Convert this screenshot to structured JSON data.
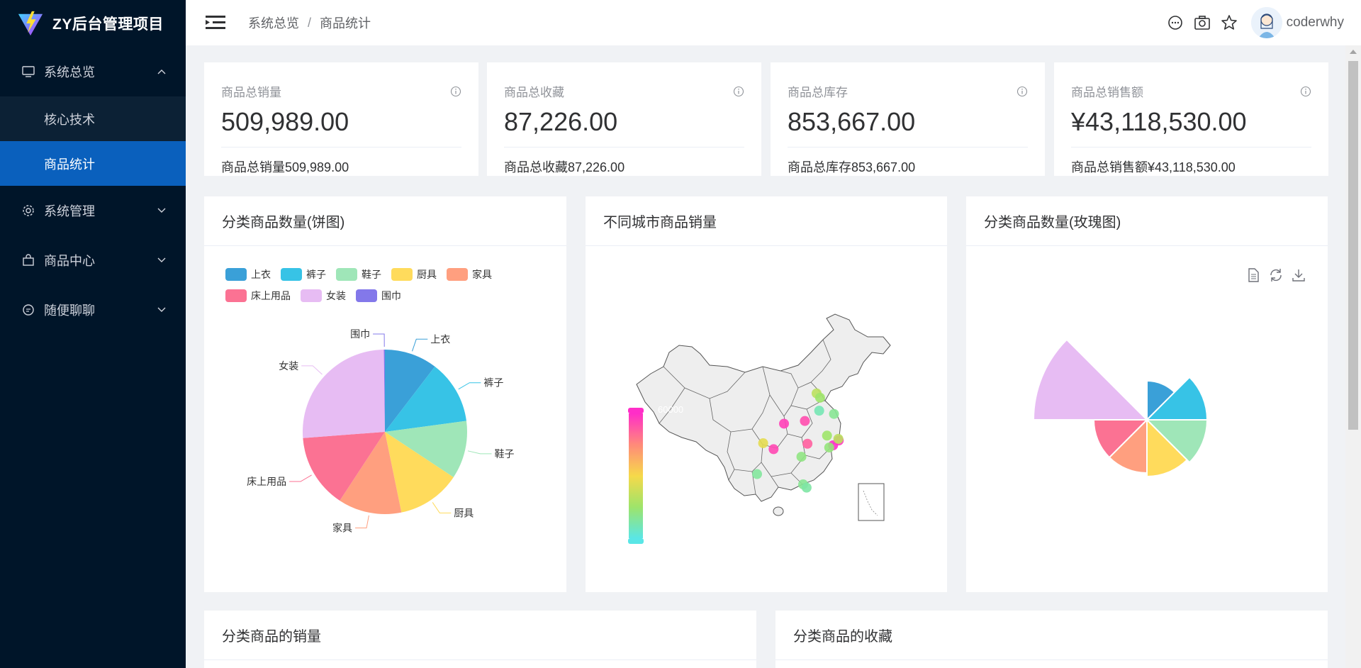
{
  "app": {
    "title": "ZY后台管理项目"
  },
  "sidebar": {
    "groups": [
      {
        "label": "系统总览",
        "icon": "monitor-icon",
        "expanded": true,
        "children": [
          {
            "label": "核心技术",
            "active": false
          },
          {
            "label": "商品统计",
            "active": true
          }
        ]
      },
      {
        "label": "系统管理",
        "icon": "gear-icon",
        "expanded": false
      },
      {
        "label": "商品中心",
        "icon": "shopping-bag-icon",
        "expanded": false
      },
      {
        "label": "随便聊聊",
        "icon": "chat-bubble-icon",
        "expanded": false
      }
    ]
  },
  "header": {
    "breadcrumb": [
      "系统总览",
      "商品统计"
    ],
    "username": "coderwhy",
    "icons": [
      "message-icon",
      "camera-icon",
      "star-icon"
    ]
  },
  "stats": [
    {
      "title": "商品总销量",
      "value": "509,989.00",
      "footer": "商品总销量509,989.00"
    },
    {
      "title": "商品总收藏",
      "value": "87,226.00",
      "footer": "商品总收藏87,226.00"
    },
    {
      "title": "商品总库存",
      "value": "853,667.00",
      "footer": "商品总库存853,667.00"
    },
    {
      "title": "商品总销售额",
      "value": "¥43,118,530.00",
      "footer": "商品总销售额¥43,118,530.00"
    }
  ],
  "panels": {
    "pie": {
      "title": "分类商品数量(饼图)"
    },
    "map": {
      "title": "不同城市商品销量",
      "visual_max": "60000"
    },
    "rose": {
      "title": "分类商品数量(玫瑰图)"
    },
    "sales": {
      "title": "分类商品的销量"
    },
    "favor": {
      "title": "分类商品的收藏"
    }
  },
  "colors": {
    "上衣": "#3aa0d8",
    "裤子": "#37c3e6",
    "鞋子": "#9fe6b8",
    "厨具": "#ffdb5c",
    "家具": "#ff9f7f",
    "床上用品": "#fb7293",
    "女装": "#e7bcf3",
    "围巾": "#8378ea"
  },
  "chart_data": [
    {
      "type": "pie",
      "title": "分类商品数量(饼图)",
      "categories": [
        "上衣",
        "裤子",
        "鞋子",
        "厨具",
        "家具",
        "床上用品",
        "女装",
        "围巾"
      ],
      "values": [
        10,
        12,
        11,
        12,
        12,
        14,
        25,
        0.2
      ],
      "legend": "top-left"
    },
    {
      "type": "rose",
      "title": "分类商品数量(玫瑰图)",
      "categories": [
        "上衣",
        "裤子",
        "鞋子",
        "厨具",
        "家具",
        "床上用品",
        "女装",
        "围巾"
      ],
      "values": [
        0.55,
        0.85,
        0.85,
        0.8,
        0.75,
        0.75,
        1.6,
        0
      ]
    },
    {
      "type": "scatter",
      "title": "不同城市商品销量",
      "visual_map_max": 60000,
      "points": [
        {
          "lng": 116.4,
          "lat": 39.9,
          "v": 20000
        },
        {
          "lng": 117.2,
          "lat": 39.1,
          "v": 15000
        },
        {
          "lng": 120.4,
          "lat": 36.1,
          "v": 10000
        },
        {
          "lng": 118.8,
          "lat": 32.1,
          "v": 15000
        },
        {
          "lng": 121.5,
          "lat": 31.2,
          "v": 58000
        },
        {
          "lng": 120.2,
          "lat": 30.3,
          "v": 60000
        },
        {
          "lng": 119.3,
          "lat": 29.9,
          "v": 13000
        },
        {
          "lng": 114.3,
          "lat": 30.6,
          "v": 52000
        },
        {
          "lng": 113.7,
          "lat": 34.8,
          "v": 55000
        },
        {
          "lng": 108.9,
          "lat": 34.3,
          "v": 57000
        },
        {
          "lng": 104.1,
          "lat": 30.7,
          "v": 27000
        },
        {
          "lng": 106.5,
          "lat": 29.6,
          "v": 56000
        },
        {
          "lng": 112.9,
          "lat": 28.2,
          "v": 12000
        },
        {
          "lng": 113.3,
          "lat": 23.1,
          "v": 10000
        },
        {
          "lng": 114.1,
          "lat": 22.5,
          "v": 8000
        },
        {
          "lng": 102.7,
          "lat": 25.0,
          "v": 9000
        },
        {
          "lng": 117.0,
          "lat": 36.7,
          "v": 6000
        },
        {
          "lng": 121.4,
          "lat": 31.5,
          "v": 20000
        }
      ]
    }
  ]
}
